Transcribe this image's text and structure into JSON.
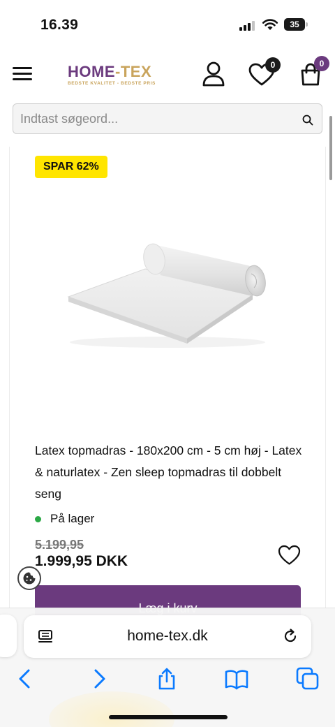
{
  "status_bar": {
    "time": "16.39",
    "battery": "35"
  },
  "header": {
    "logo_main": "HOME",
    "logo_dash": "-",
    "logo_second": "TEX",
    "logo_tagline": "BEDSTE KVALITET - BEDSTE PRIS",
    "wishlist_count": "0",
    "cart_count": "0"
  },
  "search": {
    "placeholder": "Indtast søgeord..."
  },
  "product": {
    "discount_badge": "SPAR 62%",
    "title": "Latex topmadras - 180x200 cm - 5 cm høj - Latex & naturlatex - Zen sleep topmadras til dobbelt seng",
    "stock": "På lager",
    "old_price": "5.199,95",
    "price": "1.999,95 DKK",
    "add_to_cart": "Læg i kurv"
  },
  "browser": {
    "url": "home-tex.dk"
  },
  "colors": {
    "brand_purple": "#6b3a7e",
    "brand_gold": "#c9a45c",
    "badge_yellow": "#ffe500",
    "stock_green": "#2aa845",
    "ios_blue": "#0a7aff"
  }
}
